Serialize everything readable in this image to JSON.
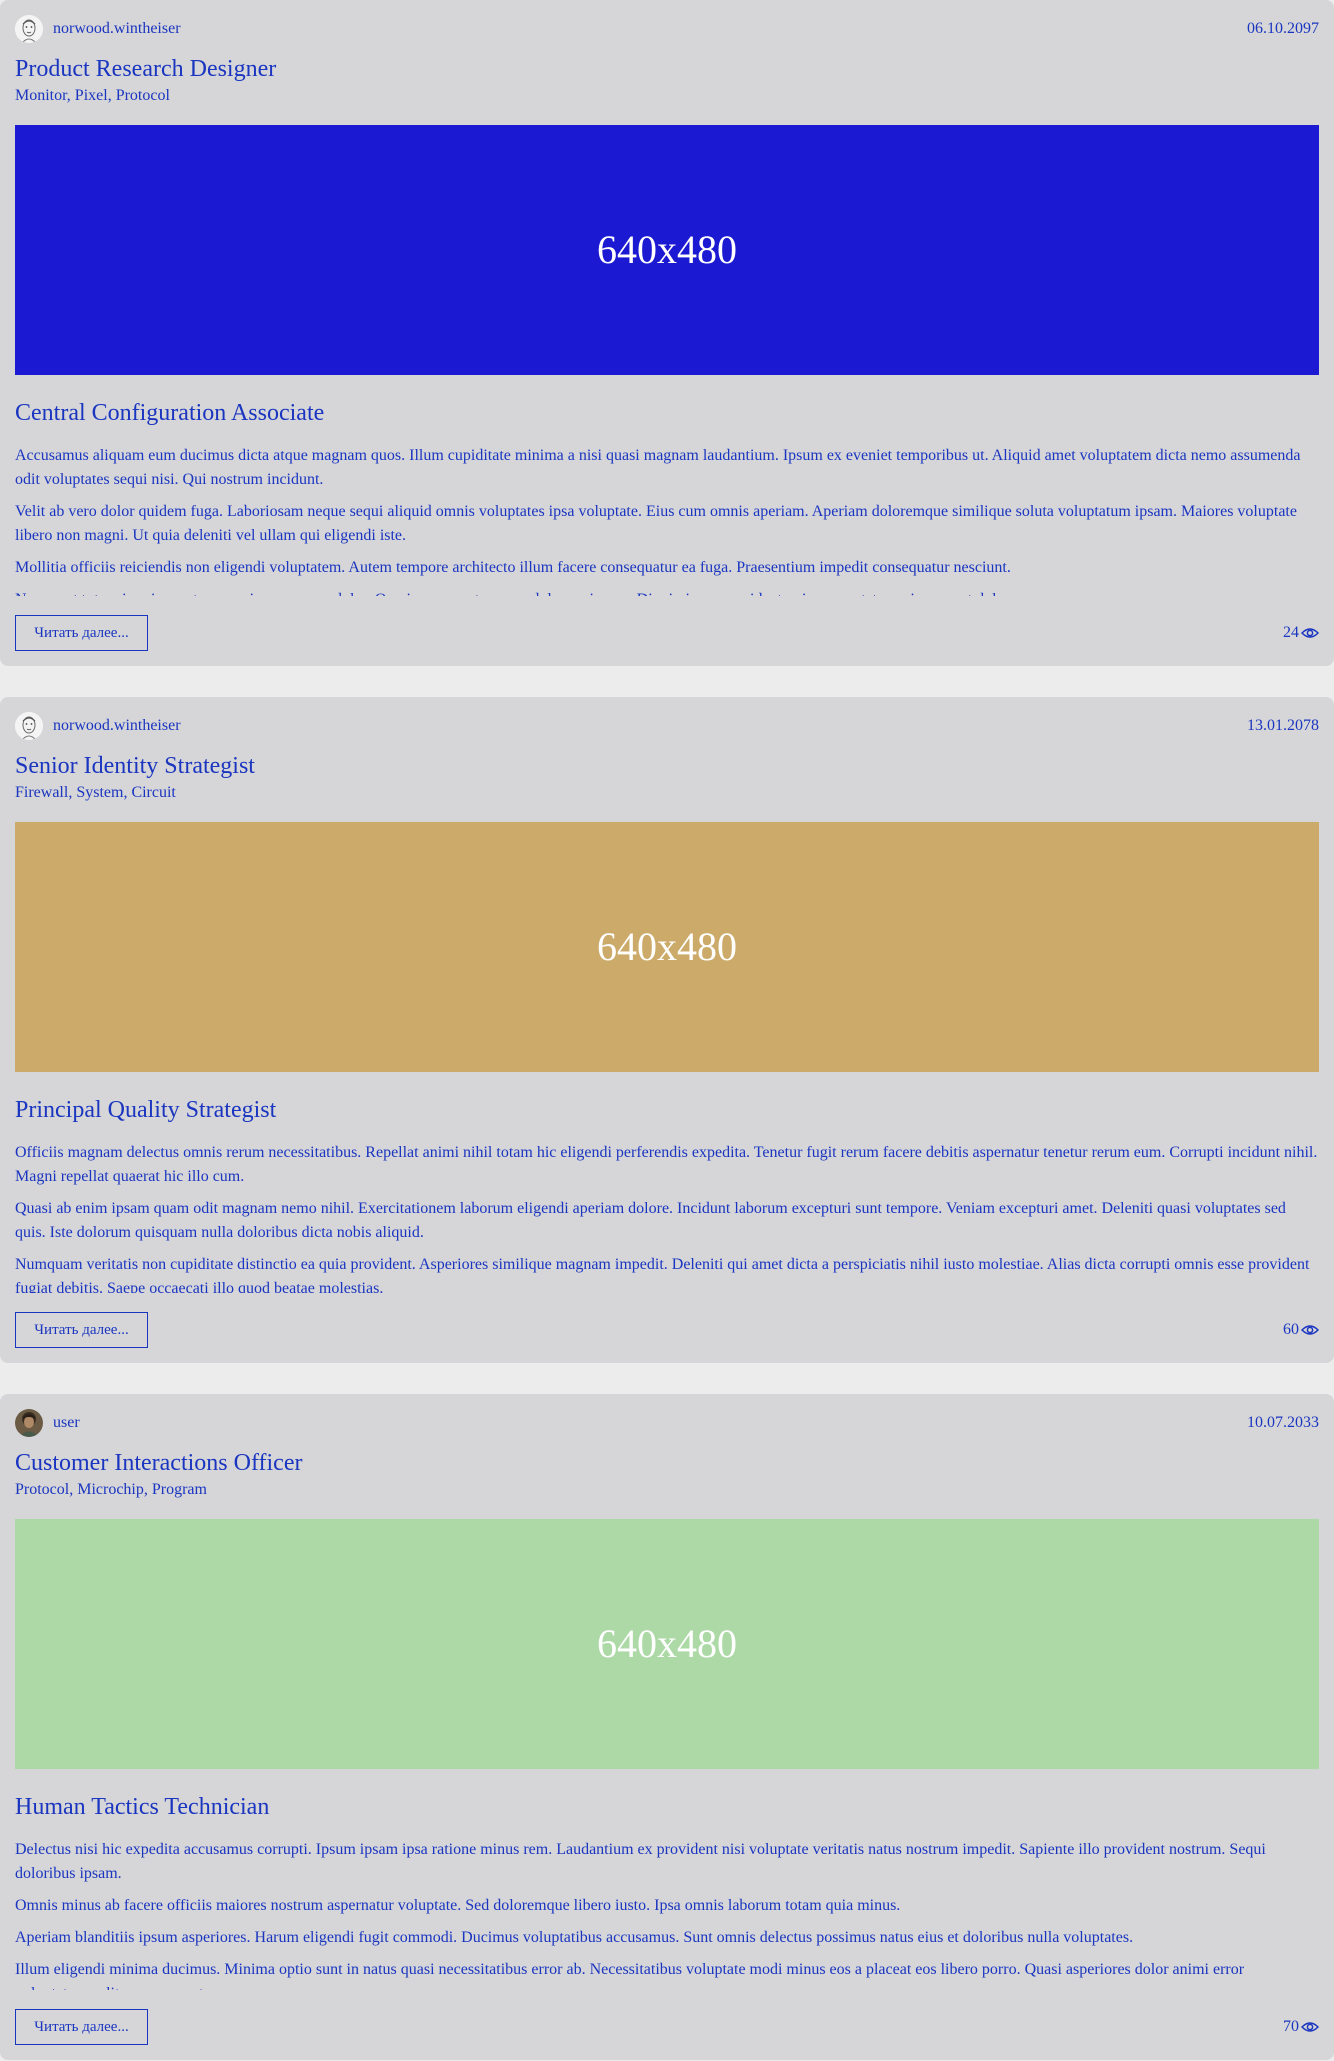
{
  "posts": [
    {
      "author": "norwood.wintheiser",
      "avatar": "sketch-face-avatar",
      "date": "06.10.2097",
      "title": "Product Research Designer",
      "tags": "Monitor, Pixel, Protocol",
      "image": {
        "label": "640x480",
        "color": "#1b19d2"
      },
      "subtitle": "Central Configuration Associate",
      "paragraphs": [
        "Accusamus aliquam eum ducimus dicta atque magnam quos. Illum cupiditate minima a nisi quasi magnam laudantium. Ipsum ex eveniet temporibus ut. Aliquid amet voluptatem dicta nemo assumenda odit voluptates sequi nisi. Qui nostrum incidunt.",
        "Velit ab vero dolor quidem fuga. Laboriosam neque sequi aliquid omnis voluptates ipsa voluptate. Eius cum omnis aperiam. Aperiam doloremque similique soluta voluptatum ipsam. Maiores voluptate libero non magni. Ut quia deleniti vel ullam qui eligendi iste.",
        "Mollitia officiis reiciendis non eligendi voluptatem. Autem tempore architecto illum facere consequatur ea fuga. Praesentium impedit consequatur nesciunt.",
        "Nemo aut totam iure ipsam tempora ipsa cumque dolor. Quo ipsa porro tempora dolorum ipsum. Dignissimos provident quia consectetur quisquam et dolorem."
      ],
      "read_more": "Читать далее...",
      "views": "24"
    },
    {
      "author": "norwood.wintheiser",
      "avatar": "sketch-face-avatar",
      "date": "13.01.2078",
      "title": "Senior Identity Strategist",
      "tags": "Firewall, System, Circuit",
      "image": {
        "label": "640x480",
        "color": "#ccaa6a"
      },
      "subtitle": "Principal Quality Strategist",
      "paragraphs": [
        "Officiis magnam delectus omnis rerum necessitatibus. Repellat animi nihil totam hic eligendi perferendis expedita. Tenetur fugit rerum facere debitis aspernatur tenetur rerum eum. Corrupti incidunt nihil. Magni repellat quaerat hic illo cum.",
        "Quasi ab enim ipsam quam odit magnam nemo nihil. Exercitationem laborum eligendi aperiam dolore. Incidunt laborum excepturi sunt tempore. Veniam excepturi amet. Deleniti quasi voluptates sed quis. Iste dolorum quisquam nulla doloribus dicta nobis aliquid.",
        "Numquam veritatis non cupiditate distinctio ea quia provident. Asperiores similique magnam impedit. Deleniti qui amet dicta a perspiciatis nihil iusto molestiae. Alias dicta corrupti omnis esse provident fugiat debitis. Saepe occaecati illo quod beatae molestias."
      ],
      "read_more": "Читать далее...",
      "views": "60"
    },
    {
      "author": "user",
      "avatar": "photo-avatar",
      "date": "10.07.2033",
      "title": "Customer Interactions Officer",
      "tags": "Protocol, Microchip, Program",
      "image": {
        "label": "640x480",
        "color": "#acd9a6"
      },
      "subtitle": "Human Tactics Technician",
      "paragraphs": [
        "Delectus nisi hic expedita accusamus corrupti. Ipsum ipsam ipsa ratione minus rem. Laudantium ex provident nisi voluptate veritatis natus nostrum impedit. Sapiente illo provident nostrum. Sequi doloribus ipsam.",
        "Omnis minus ab facere officiis maiores nostrum aspernatur voluptate. Sed doloremque libero iusto. Ipsa omnis laborum totam quia minus.",
        "Aperiam blanditiis ipsum asperiores. Harum eligendi fugit commodi. Ducimus voluptatibus accusamus. Sunt omnis delectus possimus natus eius et doloribus nulla voluptates.",
        "Illum eligendi minima ducimus. Minima optio sunt in natus quasi necessitatibus error ab. Necessitatibus voluptate modi minus eos a placeat eos libero porro. Quasi asperiores dolor animi error voluptatem velit quas neque tempora."
      ],
      "read_more": "Читать далее...",
      "views": "70"
    }
  ],
  "icons": {
    "views": "eye-icon"
  },
  "colors": {
    "accent": "#1a35c0",
    "card": "#d6d6d8",
    "page": "#ececec"
  }
}
